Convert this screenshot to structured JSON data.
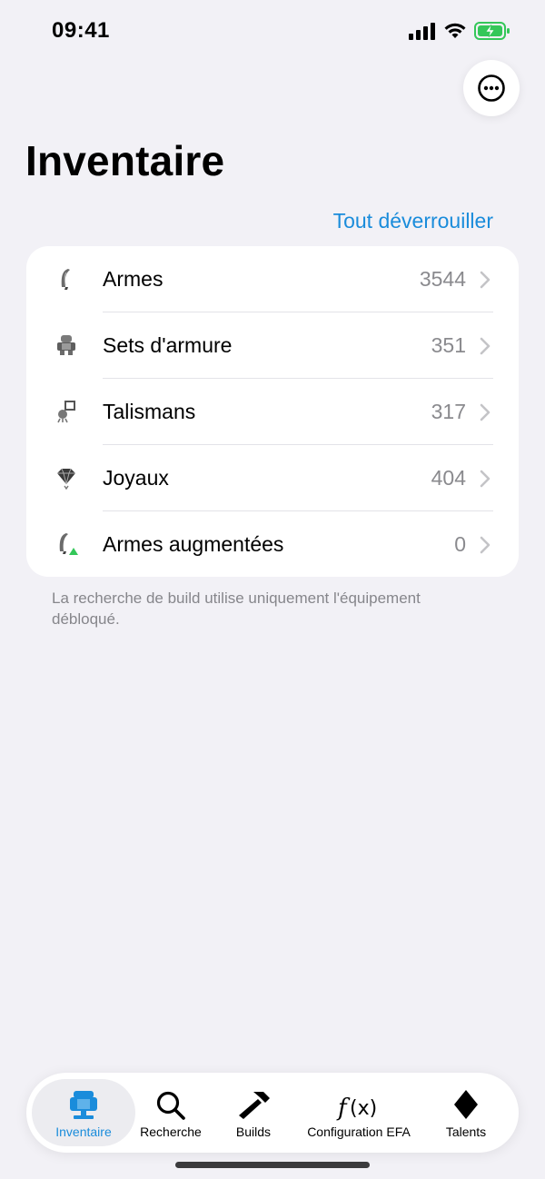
{
  "status_bar": {
    "time": "09:41"
  },
  "header": {
    "title": "Inventaire",
    "more_icon": "ellipsis-circle-icon"
  },
  "actions": {
    "unlock_all": "Tout déverrouiller"
  },
  "inventory": {
    "rows": [
      {
        "label": "Armes",
        "count": "3544",
        "icon": "weapon-icon"
      },
      {
        "label": "Sets d'armure",
        "count": "351",
        "icon": "armor-icon"
      },
      {
        "label": "Talismans",
        "count": "317",
        "icon": "talisman-icon"
      },
      {
        "label": "Joyaux",
        "count": "404",
        "icon": "gem-icon"
      },
      {
        "label": "Armes augmentées",
        "count": "0",
        "icon": "upgraded-weapon-icon"
      }
    ]
  },
  "footnote": "La recherche de build utilise uniquement l'équipement débloqué.",
  "tab_bar": {
    "tabs": [
      {
        "label": "Inventaire",
        "icon": "inventory-icon",
        "active": true
      },
      {
        "label": "Recherche",
        "icon": "search-icon",
        "active": false
      },
      {
        "label": "Builds",
        "icon": "hammer-icon",
        "active": false
      },
      {
        "label": "Configuration EFA",
        "icon": "function-icon",
        "active": false
      },
      {
        "label": "Talents",
        "icon": "diamond-icon",
        "active": false
      }
    ]
  },
  "colors": {
    "accent": "#1a8cdb",
    "background": "#f2f1f6",
    "battery": "#34c759"
  }
}
